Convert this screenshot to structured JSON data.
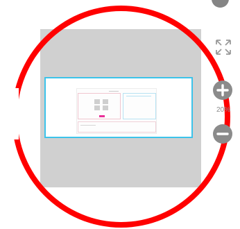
{
  "navigator": {
    "background_color": "#d0d0d0",
    "viewport_border_color": "#3cc3ea"
  },
  "annotation": {
    "shape": "circle",
    "color": "#ff0000"
  },
  "controls": {
    "zoom_label": "20%",
    "top_icon": "partial-circle-icon",
    "fullscreen_icon": "fullscreen-icon",
    "zoom_in_icon": "plus-icon",
    "zoom_out_icon": "minus-icon"
  }
}
